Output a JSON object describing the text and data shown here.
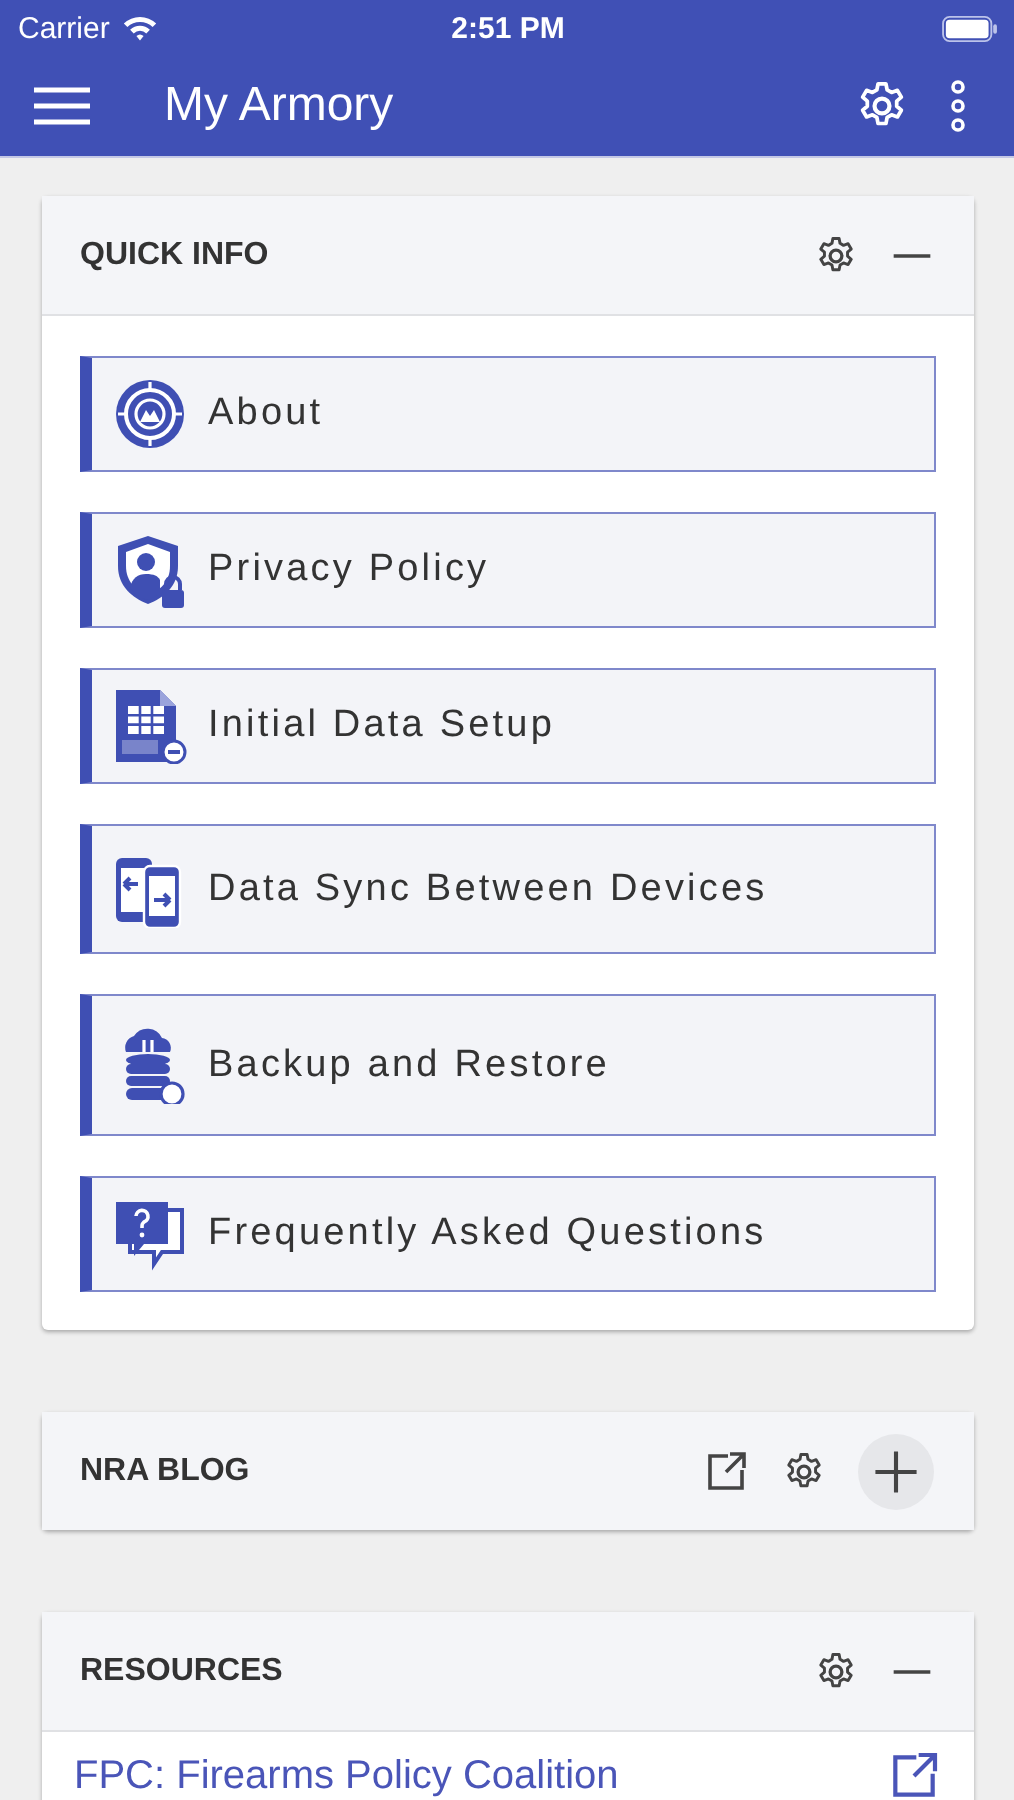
{
  "status_bar": {
    "carrier": "Carrier",
    "time": "2:51 PM"
  },
  "app_bar": {
    "title": "My Armory"
  },
  "panels": [
    {
      "title": "QUICK INFO",
      "expanded": true,
      "link_icon": false,
      "kind": "menu",
      "items": [
        {
          "label": "About",
          "kind": "about"
        },
        {
          "label": "Privacy Policy",
          "kind": "privacy"
        },
        {
          "label": "Initial Data Setup",
          "kind": "csv"
        },
        {
          "label": "Data Sync Between Devices",
          "kind": "sync"
        },
        {
          "label": "Backup and Restore",
          "kind": "backup"
        },
        {
          "label": "Frequently Asked Questions",
          "kind": "faq"
        }
      ]
    },
    {
      "title": "NRA BLOG",
      "expanded": false,
      "link_icon": true
    },
    {
      "title": "RESOURCES",
      "expanded": true,
      "link_icon": false,
      "kind": "links",
      "items": [
        {
          "label": "FPC: Firearms Policy Coalition"
        }
      ]
    }
  ]
}
